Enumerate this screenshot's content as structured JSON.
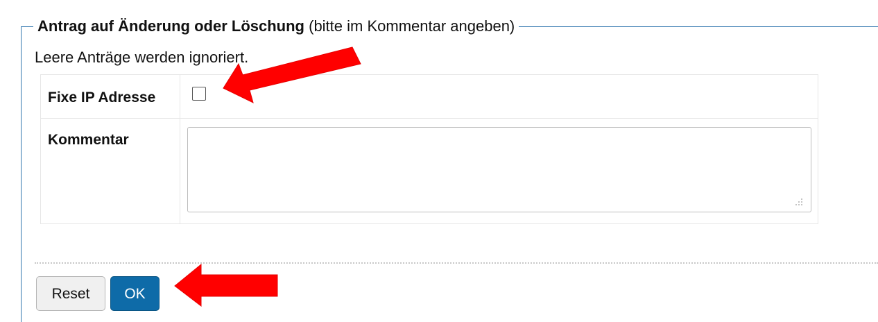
{
  "fieldset": {
    "legend_bold": "Antrag auf Änderung oder Löschung",
    "legend_normal": " (bitte im Kommentar angeben)"
  },
  "info_text": "Leere Anträge werden ignoriert.",
  "form": {
    "ip_label": "Fixe IP Adresse",
    "ip_checked": false,
    "comment_label": "Kommentar",
    "comment_value": ""
  },
  "buttons": {
    "reset_label": "Reset",
    "ok_label": "OK"
  },
  "colors": {
    "frame": "#2f74ad",
    "ok_button": "#0e6ba8",
    "annotation_arrow": "#ff0000"
  }
}
